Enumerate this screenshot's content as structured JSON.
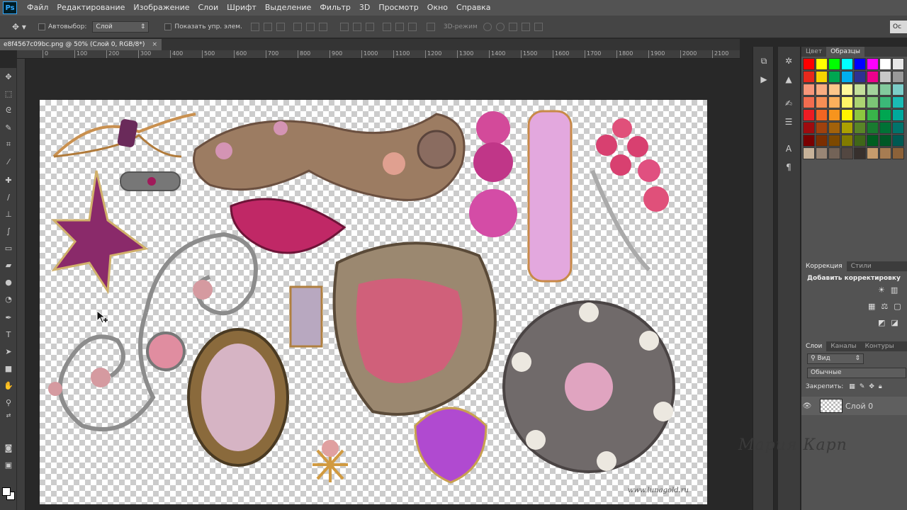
{
  "app": {
    "logo": "Ps"
  },
  "menu": [
    "Файл",
    "Редактирование",
    "Изображение",
    "Слои",
    "Шрифт",
    "Выделение",
    "Фильтр",
    "3D",
    "Просмотр",
    "Окно",
    "Справка"
  ],
  "options": {
    "autoselect_label": "Автовыбор:",
    "autoselect_value": "Слой",
    "show_controls_label": "Показать упр. элем.",
    "mode3d_label": "3D-режим",
    "right_button": "Ос"
  },
  "document": {
    "tab_title": "e8f4567c09bc.png @ 50% (Слой 0, RGB/8*)",
    "watermark": "www.lunagold.ru"
  },
  "ruler_ticks": [
    "0",
    "100",
    "200",
    "300",
    "400",
    "500",
    "600",
    "700",
    "800",
    "900",
    "1000",
    "1100",
    "1200",
    "1300",
    "1400",
    "1500",
    "1600",
    "1700",
    "1800",
    "1900",
    "2000",
    "2100"
  ],
  "panels": {
    "color_tab": "Цвет",
    "swatches_tab": "Образцы",
    "corrections_tab": "Коррекция",
    "styles_tab": "Стили",
    "corrections_title": "Добавить корректировку",
    "layers_tab": "Слои",
    "channels_tab": "Каналы",
    "paths_tab": "Контуры",
    "filter_kind": "Вид",
    "blend_mode": "Обычные",
    "lock_label": "Закрепить:",
    "layer_name": "Слой 0"
  },
  "signature": "Мария Карп",
  "colors": {
    "accent": "#31a8ff",
    "panel_bg": "#535353",
    "workspace_bg": "#282828"
  }
}
